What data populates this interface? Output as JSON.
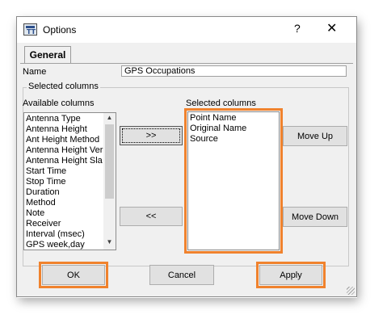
{
  "window": {
    "title": "Options",
    "help_glyph": "?",
    "close_glyph": "✕"
  },
  "tabs": [
    {
      "label": "General",
      "active": true
    }
  ],
  "name_field": {
    "label": "Name",
    "value": "GPS Occupations"
  },
  "group": {
    "label": "Selected columns"
  },
  "available": {
    "label": "Available columns",
    "items": [
      "Antenna Type",
      "Antenna Height",
      "Ant Height Method",
      "Antenna Height Ver",
      "Antenna Height Sla",
      "Start Time",
      "Stop Time",
      "Duration",
      "Method",
      "Note",
      "Receiver",
      "Interval (msec)",
      "GPS week,day"
    ]
  },
  "selected": {
    "label": "Selected columns",
    "items": [
      "Point Name",
      "Original Name",
      "Source"
    ]
  },
  "buttons": {
    "add": ">>",
    "remove": "<<",
    "move_up": "Move Up",
    "move_down": "Move Down",
    "ok": "OK",
    "cancel": "Cancel",
    "apply": "Apply"
  },
  "colors": {
    "highlight": "#f0822d",
    "window_bg": "#f0f0f0"
  },
  "icons": {
    "app": "app-icon",
    "scroll_up": "arrow-up-icon",
    "scroll_down": "arrow-down-icon"
  }
}
